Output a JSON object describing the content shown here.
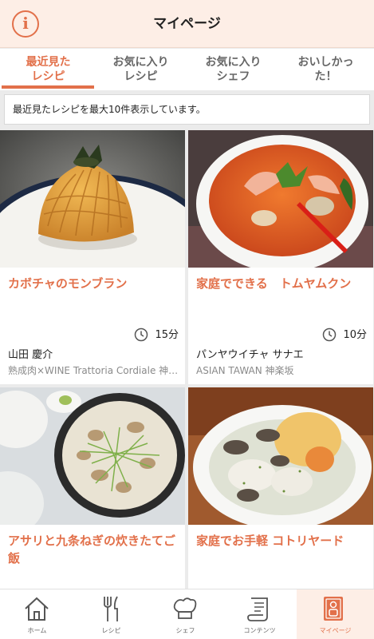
{
  "header": {
    "title": "マイページ",
    "info_label": "i"
  },
  "tabs": [
    {
      "label": "最近見た\nレシピ",
      "active": true
    },
    {
      "label": "お気に入り\nレシピ",
      "active": false
    },
    {
      "label": "お気に入り\nシェフ",
      "active": false
    },
    {
      "label": "おいしかっ\nた！",
      "active": false
    }
  ],
  "notice": "最近見たレシピを最大10件表示しています。",
  "recipes": [
    {
      "title": "カボチャのモンブラン",
      "time": "15分",
      "chef": "山田 慶介",
      "restaurant": "熟成肉×WINE Trattoria Cordiale 神楽坂",
      "photo": "pumpkin-montblanc"
    },
    {
      "title": "家庭でできる　トムヤムクン",
      "time": "10分",
      "chef": "パンヤウイチャ サナエ",
      "restaurant": "ASIAN TAWAN 神楽坂",
      "photo": "tom-yum-soup"
    },
    {
      "title": "アサリと九条ねぎの炊きたてご飯",
      "time": "",
      "chef": "",
      "restaurant": "",
      "photo": "clam-rice-pot"
    },
    {
      "title": "家庭でお手軽 コトリヤード",
      "time": "",
      "chef": "",
      "restaurant": "",
      "photo": "cotriade-stew"
    }
  ],
  "nav": [
    {
      "label": "ホーム",
      "icon": "home-icon",
      "active": false
    },
    {
      "label": "レシピ",
      "icon": "fork-knife-icon",
      "active": false
    },
    {
      "label": "シェフ",
      "icon": "chef-hat-icon",
      "active": false
    },
    {
      "label": "コンテンツ",
      "icon": "scroll-icon",
      "active": false
    },
    {
      "label": "マイページ",
      "icon": "mypage-book-icon",
      "active": true
    }
  ],
  "colors": {
    "accent": "#e2704a",
    "header_bg": "#fdeee6",
    "page_bg": "#ebebeb"
  }
}
